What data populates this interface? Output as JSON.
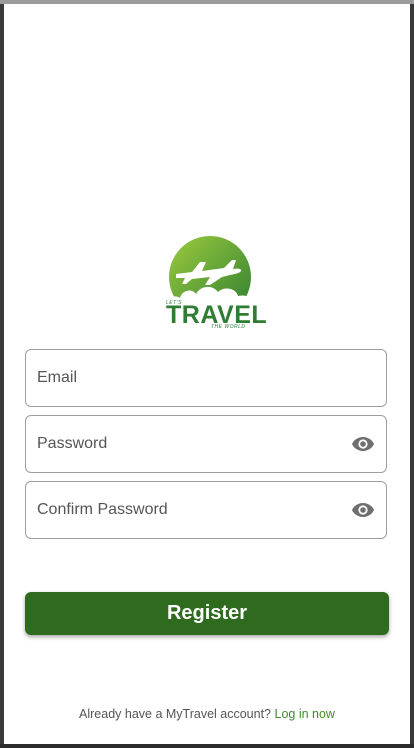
{
  "logo": {
    "small_text": "LET'S",
    "word": "TRAVEL",
    "tagline": "THE WORLD"
  },
  "form": {
    "email": {
      "placeholder": "Email",
      "value": ""
    },
    "password": {
      "placeholder": "Password",
      "value": ""
    },
    "confirm_password": {
      "placeholder": "Confirm Password",
      "value": ""
    }
  },
  "register_label": "Register",
  "footer": {
    "text": "Already have a MyTravel account?",
    "link": "Log in now"
  },
  "colors": {
    "primary_green": "#2f6b1f",
    "logo_green": "#2e7d32",
    "link_green": "#3f8b2c",
    "border": "#9e9e9e"
  },
  "icons": {
    "password_toggle": "eye-icon",
    "logo": "airplane-icon"
  }
}
